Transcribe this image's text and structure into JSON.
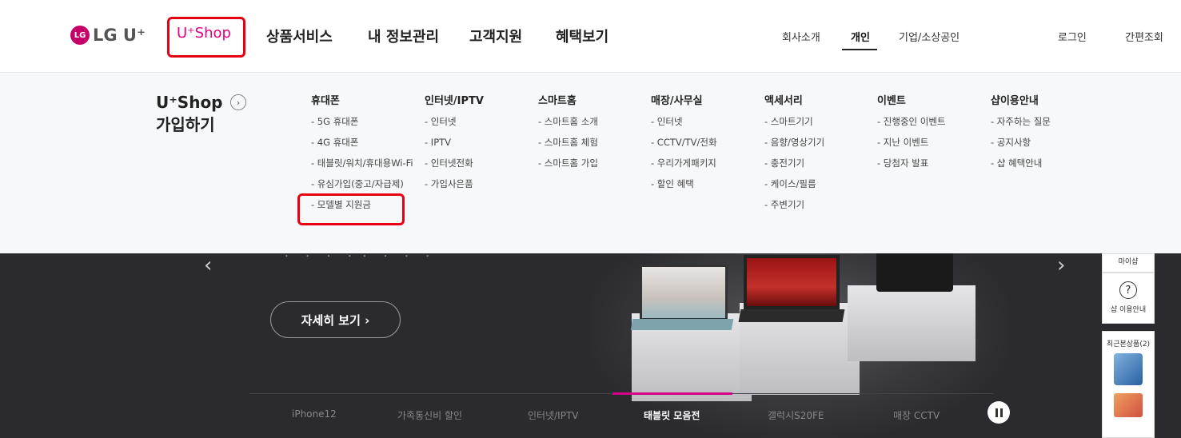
{
  "header": {
    "logo": {
      "badge": "LG",
      "text": "LG U⁺"
    },
    "ushop_tab": "U⁺Shop",
    "gnb": [
      "상품서비스",
      "내 정보관리",
      "고객지원",
      "혜택보기"
    ],
    "util": [
      "회사소개",
      "개인",
      "기업/소상공인"
    ],
    "util_active": "개인",
    "login": "로그인",
    "quick_lookup": "간편조회"
  },
  "mega": {
    "title_line1": "U⁺Shop",
    "title_line2": "가입하기",
    "arrow_icon": "›",
    "columns": [
      {
        "head": "휴대폰",
        "items": [
          "- 5G 휴대폰",
          "- 4G 휴대폰",
          "- 태블릿/워치/휴대용Wi-Fi",
          "- 유심가입(중고/자급제)",
          "- 모델별 지원금"
        ]
      },
      {
        "head": "인터넷/IPTV",
        "items": [
          "- 인터넷",
          "- IPTV",
          "- 인터넷전화",
          "- 가입사은품"
        ]
      },
      {
        "head": "스마트홈",
        "items": [
          "- 스마트홈 소개",
          "- 스마트홈 체험",
          "- 스마트홈 가입"
        ]
      },
      {
        "head": "매장/사무실",
        "items": [
          "- 인터넷",
          "- CCTV/TV/전화",
          "- 우리가게패키지",
          "- 할인 혜택"
        ]
      },
      {
        "head": "액세서리",
        "items": [
          "- 스마트기기",
          "- 음향/영상기기",
          "- 충전기기",
          "- 케이스/필름",
          "- 주변기기"
        ]
      },
      {
        "head": "이벤트",
        "items": [
          "- 진행중인 이벤트",
          "- 지난 이벤트",
          "- 당첨자 발표"
        ]
      },
      {
        "head": "샵이용안내",
        "items": [
          "- 자주하는 질문",
          "- 공지사항",
          "- 샵 혜택안내"
        ]
      }
    ]
  },
  "hero": {
    "partial_text": "ㆍ ㆍ ㆍ   ㆍㆍ ㆍ ㆍ ㆍ",
    "detail_button": "자세히 보기 ›",
    "prev_icon": "‹",
    "next_icon": "›",
    "tabs": [
      "iPhone12",
      "가족통신비 할인",
      "인터넷/IPTV",
      "태블릿 모음전",
      "갤럭시S20FE",
      "매장 CCTV"
    ],
    "active_tab": "태블릿 모음전"
  },
  "quick": {
    "myshop": "마이샵",
    "help_icon": "?",
    "shop_guide": "샵 이용안내",
    "recent": "최근본상품(2)"
  }
}
